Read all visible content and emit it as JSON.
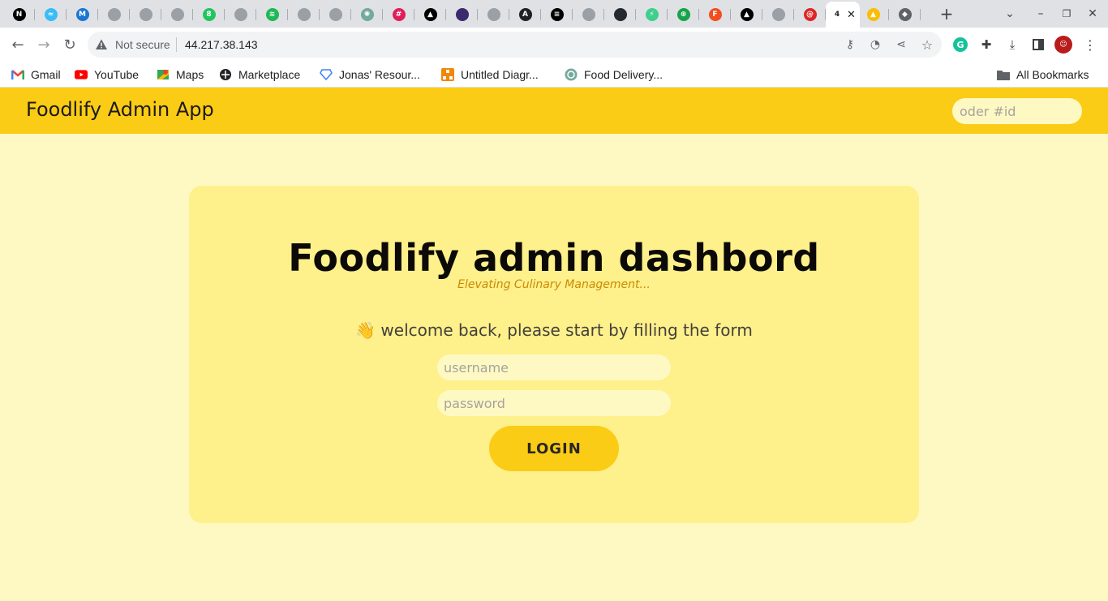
{
  "browser": {
    "tabs": [
      {
        "icon": "nextjs-icon",
        "glyph": "N",
        "bg": "#000000"
      },
      {
        "icon": "tailwind-icon",
        "glyph": "≈",
        "bg": "#38bdf8"
      },
      {
        "icon": "mui-icon",
        "glyph": "M",
        "bg": "#1976d2"
      },
      {
        "icon": "globe-icon",
        "glyph": "",
        "bg": "#9aa0a6"
      },
      {
        "icon": "globe-icon",
        "glyph": "",
        "bg": "#9aa0a6"
      },
      {
        "icon": "globe-icon",
        "glyph": "",
        "bg": "#9aa0a6"
      },
      {
        "icon": "green-8-icon",
        "glyph": "8",
        "bg": "#22c55e"
      },
      {
        "icon": "globe-icon",
        "glyph": "",
        "bg": "#9aa0a6"
      },
      {
        "icon": "spotify-icon",
        "glyph": "≋",
        "bg": "#1db954"
      },
      {
        "icon": "github-icon",
        "glyph": "",
        "bg": "#9aa0a6"
      },
      {
        "icon": "github-icon",
        "glyph": "",
        "bg": "#9aa0a6"
      },
      {
        "icon": "chatgpt-icon",
        "glyph": "✺",
        "bg": "#74aa9c"
      },
      {
        "icon": "slack-icon",
        "glyph": "#",
        "bg": "#e01e5a"
      },
      {
        "icon": "vercel-icon",
        "glyph": "▲",
        "bg": "#000000"
      },
      {
        "icon": "profile-photo-icon",
        "glyph": "",
        "bg": "#3b2a6e"
      },
      {
        "icon": "globe-icon",
        "glyph": "",
        "bg": "#9aa0a6"
      },
      {
        "icon": "a-circle-icon",
        "glyph": "A",
        "bg": "#202124"
      },
      {
        "icon": "dark-circle-icon",
        "glyph": "≡",
        "bg": "#000000"
      },
      {
        "icon": "github-icon",
        "glyph": "",
        "bg": "#9aa0a6"
      },
      {
        "icon": "github-icon",
        "glyph": "",
        "bg": "#24292f"
      },
      {
        "icon": "supabase-icon",
        "glyph": "⚡",
        "bg": "#3ecf8e"
      },
      {
        "icon": "green-globe-icon",
        "glyph": "⊕",
        "bg": "#16a34a"
      },
      {
        "icon": "figma-icon",
        "glyph": "F",
        "bg": "#f24e1e"
      },
      {
        "icon": "vercel-icon",
        "glyph": "▲",
        "bg": "#000000"
      },
      {
        "icon": "globe-icon",
        "glyph": "",
        "bg": "#9aa0a6"
      },
      {
        "icon": "spiral-icon",
        "glyph": "@",
        "bg": "#dc2626"
      },
      {
        "icon": "active-tab-icon",
        "glyph": "4",
        "bg": "#ffffff"
      },
      {
        "icon": "google-drive-icon",
        "glyph": "▲",
        "bg": "#fbbc04"
      },
      {
        "icon": "layers-icon",
        "glyph": "◆",
        "bg": "#5f6368"
      }
    ],
    "not_secure_label": "Not secure",
    "url": "44.217.38.143"
  },
  "bookmarks": [
    {
      "label": "Gmail",
      "icon": "gmail-icon"
    },
    {
      "label": "YouTube",
      "icon": "youtube-icon"
    },
    {
      "label": "Maps",
      "icon": "maps-icon"
    },
    {
      "label": "Marketplace",
      "icon": "marketplace-icon"
    },
    {
      "label": "Jonas' Resour...",
      "icon": "diamond-icon"
    },
    {
      "label": "Untitled Diagr...",
      "icon": "drawio-icon"
    },
    {
      "label": "Food Delivery...",
      "icon": "chatgpt-icon"
    }
  ],
  "all_bookmarks_label": "All Bookmarks",
  "header": {
    "title": "Foodlify Admin App",
    "search_placeholder": "oder #id"
  },
  "login": {
    "title": "Foodlify admin dashbord",
    "subtitle": "Elevating Culinary Management...",
    "welcome": "👋 welcome back, please start by filling the form",
    "username_placeholder": "username",
    "password_placeholder": "password",
    "button_label": "LOGIN"
  },
  "colors": {
    "header_bg": "#facc15",
    "page_bg": "#fef9c3",
    "card_bg": "#fef08a",
    "accent_text": "#ca8a04"
  }
}
